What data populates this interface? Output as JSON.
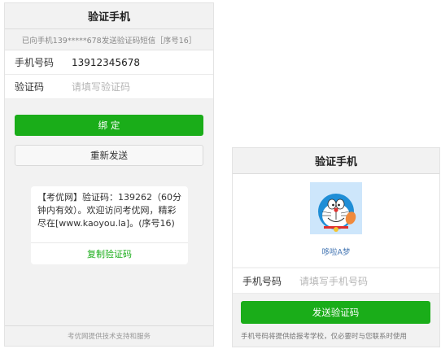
{
  "bind_screen": {
    "title": "验证手机",
    "notice": "已向手机139*****678发送验证码短信［序号16］",
    "phone_label": "手机号码",
    "phone_value": "13912345678",
    "code_label": "验证码",
    "code_placeholder": "请填写验证码",
    "bind_button": "绑 定",
    "resend_button": "重新发送",
    "sms_message": "【考优网】验证码：139262（60分钟内有效）。欢迎访问考优网，精彩尽在[www.kaoyou.la]。(序号16)",
    "copy_code": "复制验证码",
    "footer": "考优网提供技术支持和服务"
  },
  "send_screen": {
    "title": "验证手机",
    "nickname": "哆啦A梦",
    "phone_label": "手机号码",
    "phone_placeholder": "请填写手机号码",
    "send_button": "发送验证码",
    "hint": "手机号码将提供给报考学校，仅必要时与您联系时使用"
  },
  "colors": {
    "accent_green": "#1aad19",
    "link_blue": "#4a7ab5",
    "avatar_bg": "#cde6fb"
  },
  "icons": {
    "avatar": "doraemon-avatar-icon"
  }
}
